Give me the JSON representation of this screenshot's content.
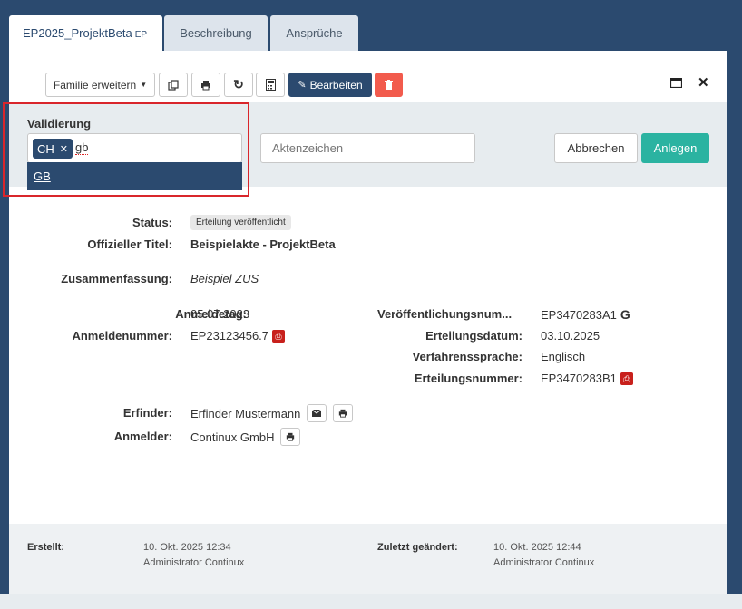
{
  "tabs": [
    {
      "label": "EP2025_ProjektBeta",
      "suffix": "EP"
    },
    {
      "label": "Beschreibung"
    },
    {
      "label": "Ansprüche"
    }
  ],
  "toolbar": {
    "family_label": "Familie erweitern",
    "edit_label": "Bearbeiten",
    "icons": [
      "copy-icon",
      "print-icon",
      "refresh-icon",
      "calculator-icon",
      "edit-icon",
      "trash-icon",
      "maximize-icon",
      "close-icon"
    ]
  },
  "validation": {
    "label": "Validierung",
    "selected_tag": "CH",
    "typed_value": "gb",
    "dropdown_option": "GB"
  },
  "aktenzeichen": {
    "placeholder": "Aktenzeichen"
  },
  "actions": {
    "cancel": "Abbrechen",
    "create": "Anlegen"
  },
  "details": {
    "status_label": "Status:",
    "status_value": "Erteilung veröffentlicht",
    "title_label": "Offizieller Titel:",
    "title_value": "Beispielakte - ProjektBeta",
    "summary_label": "Zusammenfassung:",
    "summary_value": "Beispiel ZUS",
    "filing_date_label": "Anmeldetag:",
    "filing_date_value": "05.07.2023",
    "app_number_label": "Anmeldenummer:",
    "app_number_value": "EP23123456.7",
    "pub_number_label": "Veröffentlichungsnum...",
    "pub_number_value": "EP3470283A1",
    "grant_date_label": "Erteilungsdatum:",
    "grant_date_value": "03.10.2025",
    "language_label": "Verfahrenssprache:",
    "language_value": "Englisch",
    "grant_number_label": "Erteilungsnummer:",
    "grant_number_value": "EP3470283B1",
    "inventor_label": "Erfinder:",
    "inventor_value": "Erfinder Mustermann",
    "applicant_label": "Anmelder:",
    "applicant_value": "Continux GmbH"
  },
  "footer": {
    "created_label": "Erstellt:",
    "created_date": "10. Okt. 2025 12:34",
    "created_by": "Administrator Continux",
    "modified_label": "Zuletzt geändert:",
    "modified_date": "10. Okt. 2025 12:44",
    "modified_by": "Administrator Continux"
  }
}
